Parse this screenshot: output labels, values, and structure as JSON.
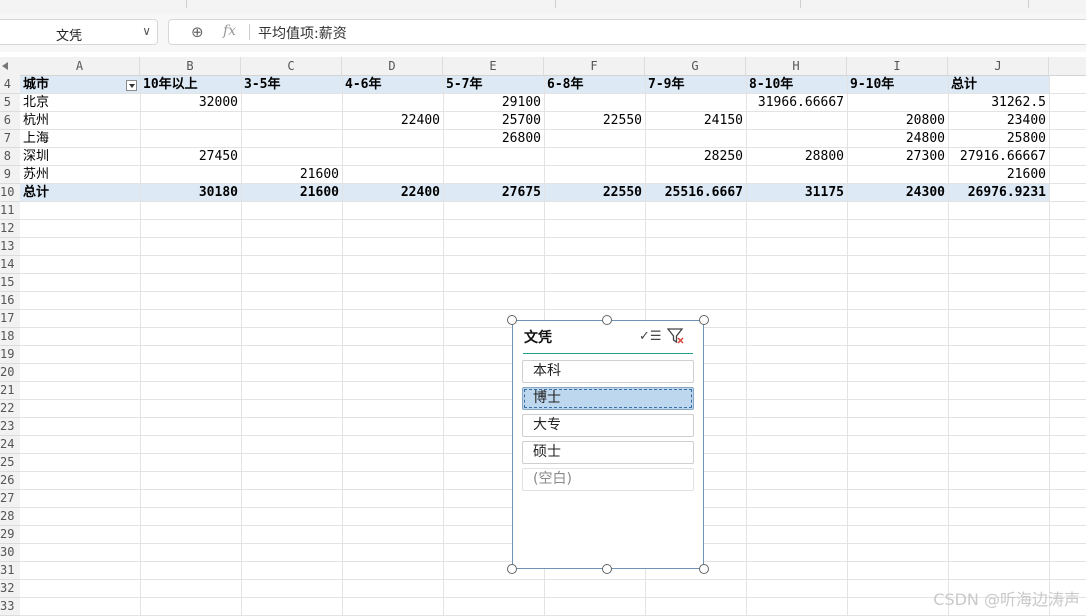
{
  "name_box": "文凭",
  "formula": {
    "fx_label": "fx",
    "value": "平均值项:薪资"
  },
  "columns": [
    "A",
    "B",
    "C",
    "D",
    "E",
    "F",
    "G",
    "H",
    "I",
    "J"
  ],
  "rows": [
    "4",
    "5",
    "6",
    "7",
    "8",
    "9",
    "10",
    "11",
    "12",
    "13",
    "14",
    "15",
    "16",
    "17",
    "18",
    "19",
    "20",
    "21",
    "22",
    "23",
    "24",
    "25",
    "26",
    "27",
    "28",
    "29",
    "30",
    "31",
    "32",
    "33"
  ],
  "pivot": {
    "row_label": "城市",
    "headers": [
      "10年以上",
      "3-5年",
      "4-6年",
      "5-7年",
      "6-8年",
      "7-9年",
      "8-10年",
      "9-10年",
      "总计"
    ],
    "data": [
      {
        "city": "北京",
        "cells": [
          "32000",
          "",
          "",
          "29100",
          "",
          "",
          "31966.66667",
          "",
          "31262.5"
        ]
      },
      {
        "city": "杭州",
        "cells": [
          "",
          "",
          "22400",
          "25700",
          "22550",
          "24150",
          "",
          "20800",
          "23400"
        ]
      },
      {
        "city": "上海",
        "cells": [
          "",
          "",
          "",
          "26800",
          "",
          "",
          "",
          "24800",
          "25800"
        ]
      },
      {
        "city": "深圳",
        "cells": [
          "27450",
          "",
          "",
          "",
          "",
          "28250",
          "28800",
          "27300",
          "27916.66667"
        ]
      },
      {
        "city": "苏州",
        "cells": [
          "",
          "21600",
          "",
          "",
          "",
          "",
          "",
          "",
          "21600"
        ]
      }
    ],
    "total_label": "总计",
    "totals": [
      "30180",
      "21600",
      "22400",
      "27675",
      "22550",
      "25516.6667",
      "31175",
      "24300",
      "26976.9231"
    ]
  },
  "slicer": {
    "title": "文凭",
    "multiselect_icon": "multi-select-icon",
    "clear_icon": "clear-filter-icon",
    "items": [
      {
        "label": "本科",
        "state": "normal"
      },
      {
        "label": "博士",
        "state": "selected"
      },
      {
        "label": "大专",
        "state": "normal"
      },
      {
        "label": "硕士",
        "state": "normal"
      },
      {
        "label": "(空白)",
        "state": "empty"
      }
    ]
  },
  "watermark": "CSDN @听海边涛声",
  "colors": {
    "band": "#dde9f5",
    "selected_item": "#bdd7ee",
    "accent_line": "#1f9c8b"
  }
}
